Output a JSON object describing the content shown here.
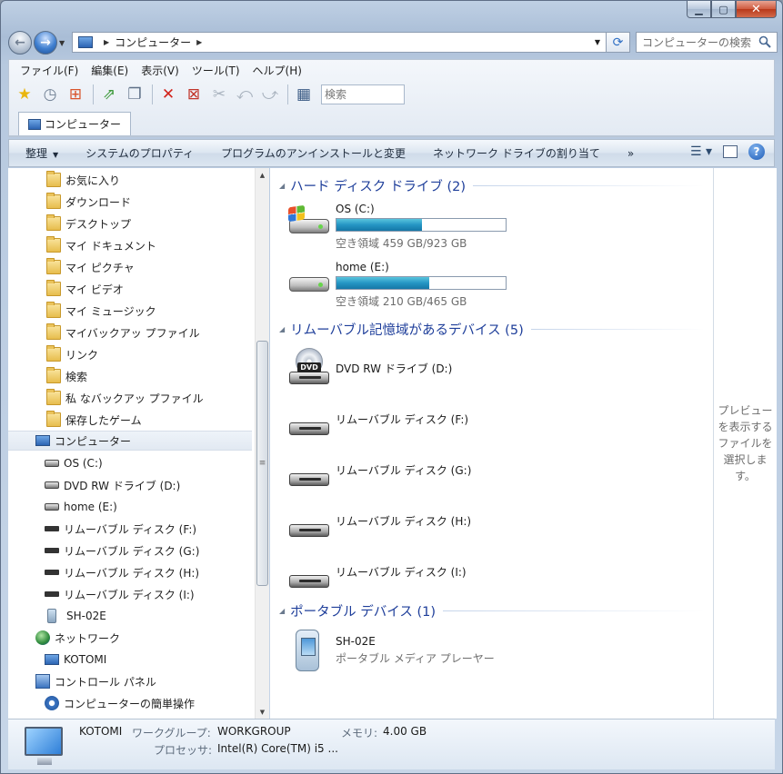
{
  "address_bar": {
    "location": "コンピューター"
  },
  "search": {
    "placeholder": "コンピューターの検索"
  },
  "menu": [
    "ファイル(F)",
    "編集(E)",
    "表示(V)",
    "ツール(T)",
    "ヘルプ(H)"
  ],
  "toolbar": {
    "search_placeholder": "検索"
  },
  "tab": {
    "label": "コンピューター"
  },
  "command_bar": {
    "organize": "整理",
    "system_properties": "システムのプロパティ",
    "uninstall": "プログラムのアンインストールと変更",
    "map_drive": "ネットワーク ドライブの割り当て",
    "more": "»"
  },
  "nav_tree": {
    "favorites": "お気に入り",
    "downloads": "ダウンロード",
    "desktop": "デスクトップ",
    "my_documents": "マイ ドキュメント",
    "my_pictures": "マイ ピクチャ",
    "my_videos": "マイ ビデオ",
    "my_music": "マイ ミュージック",
    "my_backup": "マイバックアッ プファイル",
    "links": "リンク",
    "searches": "検索",
    "private_backup": "私 なバックアッ プファイル",
    "saved_games": "保存したゲーム",
    "computer": "コンピューター",
    "drive_c": "OS (C:)",
    "drive_d": "DVD RW ドライブ (D:)",
    "drive_e": "home (E:)",
    "drive_f": "リムーバブル ディスク (F:)",
    "drive_g": "リムーバブル ディスク (G:)",
    "drive_h": "リムーバブル ディスク (H:)",
    "drive_i": "リムーバブル ディスク (I:)",
    "sh02e": "SH-02E",
    "network": "ネットワーク",
    "kotomi": "KOTOMI",
    "control_panel": "コントロール パネル",
    "ease_of_access": "コンピューターの簡単操作"
  },
  "groups": {
    "hdd": "ハード ディスク ドライブ (2)",
    "removable": "リムーバブル記憶域があるデバイス (5)",
    "portable": "ポータブル デバイス (1)"
  },
  "drives": {
    "c": {
      "name": "OS (C:)",
      "space": "空き領域 459 GB/923 GB",
      "used_fraction": 0.503
    },
    "e": {
      "name": "home (E:)",
      "space": "空き領域 210 GB/465 GB",
      "used_fraction": 0.548
    },
    "d": {
      "name": "DVD RW ドライブ (D:)",
      "badge": "DVD"
    },
    "f": {
      "name": "リムーバブル ディスク (F:)"
    },
    "g": {
      "name": "リムーバブル ディスク (G:)"
    },
    "h": {
      "name": "リムーバブル ディスク (H:)"
    },
    "i": {
      "name": "リムーバブル ディスク (I:)"
    }
  },
  "portable_device": {
    "name": "SH-02E",
    "type": "ポータブル メディア プレーヤー"
  },
  "preview_text": "プレビューを表示するファイルを選択します。",
  "details": {
    "name": "KOTOMI",
    "workgroup_label": "ワークグループ:",
    "workgroup_value": "WORKGROUP",
    "memory_label": "メモリ:",
    "memory_value": "4.00 GB",
    "processor_label": "プロセッサ:",
    "processor_value": "Intel(R) Core(TM) i5 ..."
  }
}
